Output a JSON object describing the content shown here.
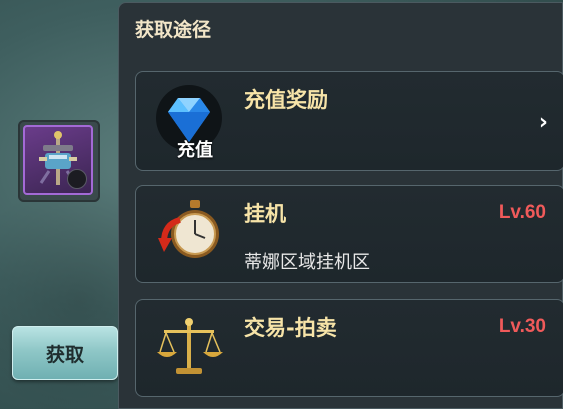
{
  "panel": {
    "title": "获取途径"
  },
  "left": {
    "get_button_label": "获取"
  },
  "entries": [
    {
      "title": "充值奖励",
      "icon": "diamond-icon",
      "icon_label": "充值",
      "action": "chevron-right-icon"
    },
    {
      "title": "挂机",
      "subtitle": "蒂娜区域挂机区",
      "level": "Lv.60",
      "icon": "stopwatch-icon"
    },
    {
      "title": "交易-拍卖",
      "level": "Lv.30",
      "icon": "scales-icon"
    }
  ],
  "colors": {
    "title_gold": "#f7e4a8",
    "level_red": "#f05a5a",
    "panel_bg": "#2a3338",
    "button_teal": "#8fc7c7",
    "item_border_purple": "#a36ad6"
  }
}
